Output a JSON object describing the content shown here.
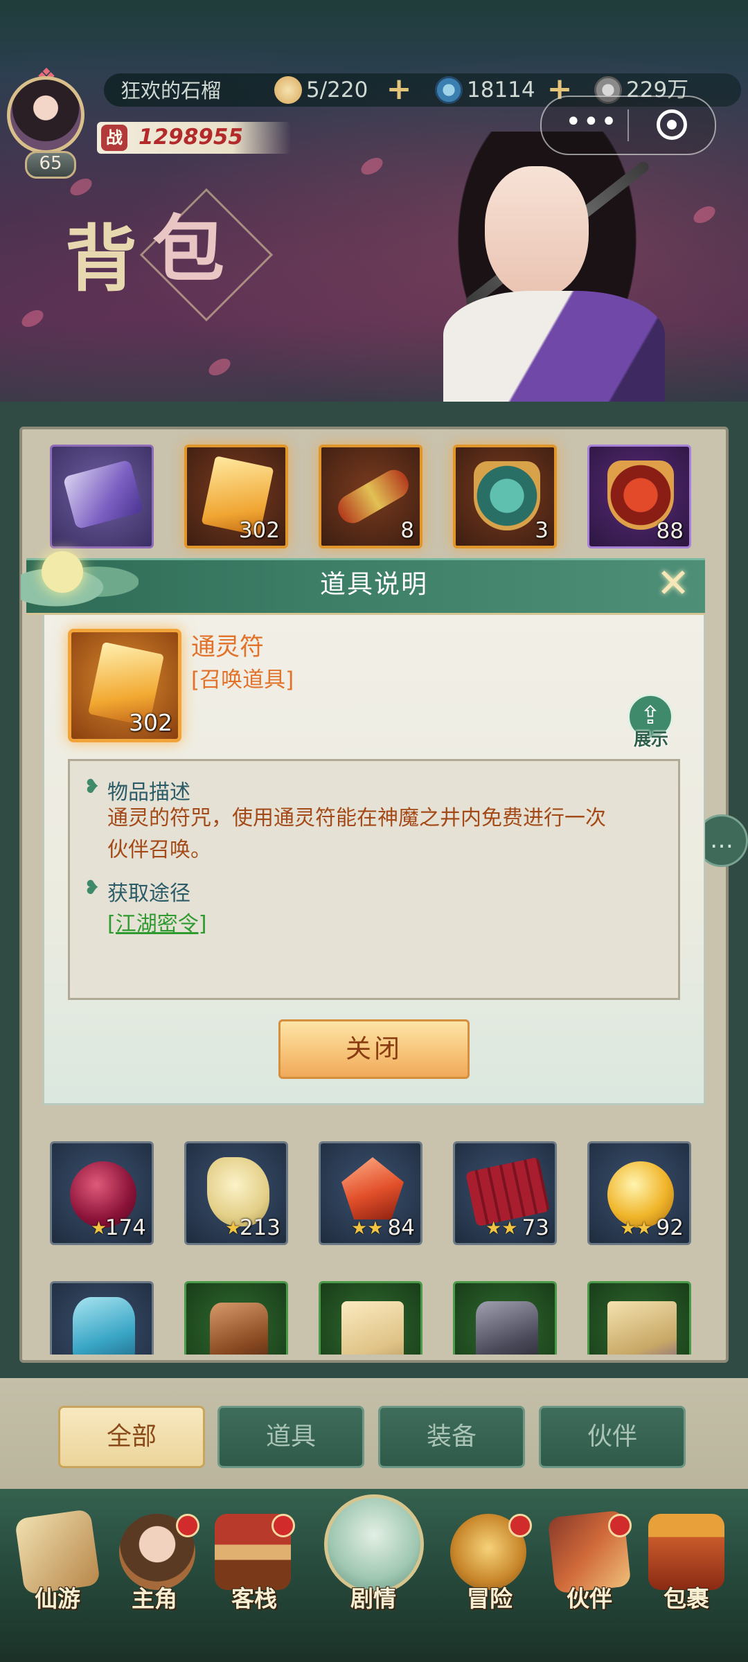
{
  "player": {
    "name": "狂欢的石榴",
    "level": "65",
    "power_label": "战",
    "power": "1298955"
  },
  "resources": [
    {
      "name": "stamina",
      "value": "5/220",
      "icon": "bun-icon",
      "has_plus": true
    },
    {
      "name": "gold",
      "value": "18114",
      "icon": "swirl-coin-icon",
      "has_plus": true
    },
    {
      "name": "silver",
      "value": "229万",
      "icon": "silver-coin-icon",
      "has_plus": false
    }
  ],
  "page_title": {
    "char1": "背",
    "char2": "包"
  },
  "bag": {
    "row1": [
      {
        "icon": "purple-scroll-icon",
        "count": ""
      },
      {
        "icon": "spirit-talisman-icon",
        "count": "302"
      },
      {
        "icon": "red-scroll-icon",
        "count": "8"
      },
      {
        "icon": "jade-shield-icon",
        "count": "3"
      },
      {
        "icon": "red-shield-icon",
        "count": "88"
      }
    ],
    "row2": [
      {
        "icon": "crimson-orb-icon",
        "stars": "★",
        "count": "174"
      },
      {
        "icon": "cream-stone-icon",
        "stars": "★",
        "count": "213"
      },
      {
        "icon": "red-crystal-icon",
        "stars": "★★",
        "count": "84"
      },
      {
        "icon": "red-cloth-icon",
        "stars": "★★",
        "count": "73"
      },
      {
        "icon": "golden-orb-icon",
        "stars": "★★",
        "count": "92"
      }
    ],
    "row3": [
      {
        "icon": "blue-ore-icon"
      },
      {
        "icon": "brown-ore-icon"
      },
      {
        "icon": "parchment-icon"
      },
      {
        "icon": "dark-ore-icon"
      },
      {
        "icon": "map-scroll-icon"
      }
    ]
  },
  "dialog": {
    "title": "道具说明",
    "item_name": "通灵符",
    "item_type": "[召唤道具]",
    "item_count": "302",
    "share_label": "展示",
    "desc_heading": "物品描述",
    "desc_line1": "通灵的符咒，使用通灵符能在神魔之井内免费进行一次",
    "desc_line2": "伙伴召唤。",
    "source_heading": "获取途径",
    "source_link": "[江湖密令]",
    "close_label": "关闭"
  },
  "tabs": [
    "全部",
    "道具",
    "装备",
    "伙伴"
  ],
  "active_tab": "全部",
  "nav": [
    "仙游",
    "主角",
    "客栈",
    "剧情",
    "冒险",
    "伙伴",
    "包裹"
  ],
  "colors": {
    "accent_green": "#3f8a6a",
    "gold": "#f1a43a",
    "text_orange": "#e2722a"
  }
}
